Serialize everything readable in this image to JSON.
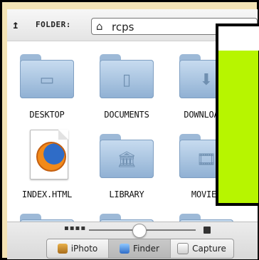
{
  "toolbar": {
    "up_icon": "up-arrow-icon",
    "folder_label": "FOLDER:",
    "path_icon": "home-icon",
    "path_value": "rcps"
  },
  "items": [
    {
      "label": "DESKTOP",
      "type": "folder",
      "icon": "folder-desktop-icon"
    },
    {
      "label": "DOCUMENTS",
      "type": "folder",
      "icon": "folder-documents-icon"
    },
    {
      "label": "DOWNLOADS",
      "type": "folder",
      "icon": "folder-downloads-icon"
    },
    {
      "label": "INDEX.HTML",
      "type": "file",
      "icon": "firefox-document-icon"
    },
    {
      "label": "LIBRARY",
      "type": "folder",
      "icon": "folder-library-icon"
    },
    {
      "label": "MOVIES",
      "type": "folder",
      "icon": "folder-movies-icon"
    }
  ],
  "bottom": {
    "zoom_level_fraction": 0.45,
    "segments": [
      {
        "label": "iPhoto",
        "icon": "iphoto-icon",
        "active": false
      },
      {
        "label": "Finder",
        "icon": "finder-icon",
        "active": true
      },
      {
        "label": "Capture",
        "icon": "capture-icon",
        "active": false
      }
    ]
  }
}
